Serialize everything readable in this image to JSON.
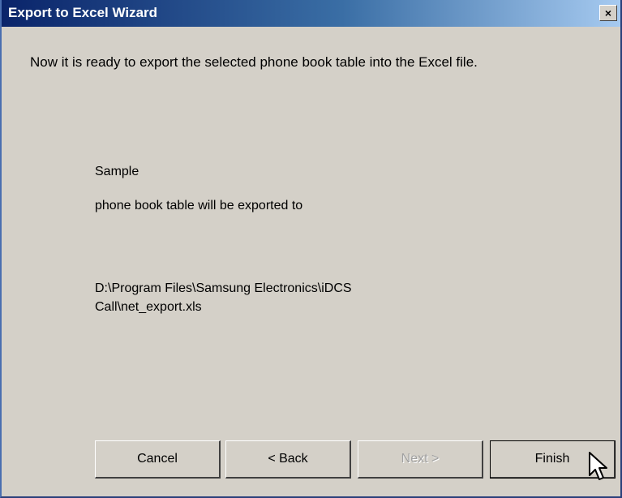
{
  "window": {
    "title": "Export to Excel Wizard",
    "close_glyph": "×"
  },
  "intro": "Now it is ready to export the selected phone book table into the Excel file.",
  "table_name": "Sample",
  "export_sentence": "phone book table will be exported to",
  "path_line1": "D:\\Program Files\\Samsung Electronics\\iDCS",
  "path_line2": "Call\\net_export.xls",
  "buttons": {
    "cancel": "Cancel",
    "back": "< Back",
    "next": "Next >",
    "finish": "Finish"
  },
  "icons": {
    "close": "close-icon",
    "cursor": "mouse-pointer-icon"
  },
  "colors": {
    "titlebar_start": "#0a246a",
    "titlebar_end": "#a6caf0",
    "face": "#d4d0c8"
  }
}
